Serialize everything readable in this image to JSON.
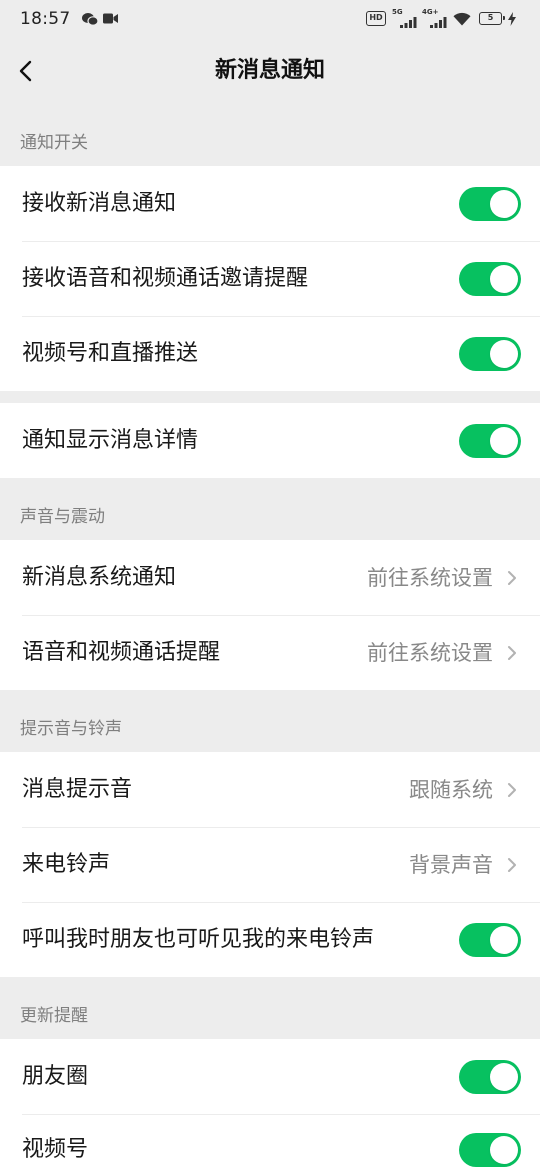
{
  "status_bar": {
    "time": "18:57",
    "hd_label": "HD",
    "sim1_label": "5G",
    "sim2_label": "4G+",
    "battery_level": "5",
    "left_icons": [
      "wechat-icon",
      "video-icon"
    ],
    "right_icons": [
      "hd-icon",
      "signal-icon",
      "signal-icon",
      "wifi-icon",
      "battery-icon",
      "charging-icon"
    ]
  },
  "nav": {
    "title": "新消息通知",
    "back_icon": "chevron-left-icon"
  },
  "colors": {
    "background": "#ededed",
    "card": "#ffffff",
    "accent": "#07c160",
    "secondary_text": "#888888"
  },
  "groups": [
    {
      "header": "通知开关",
      "rows": [
        {
          "label": "接收新消息通知",
          "toggle": true
        },
        {
          "label": "接收语音和视频通话邀请提醒",
          "toggle": true
        },
        {
          "label": "视频号和直播推送",
          "toggle": true
        }
      ]
    },
    {
      "rows": [
        {
          "label": "通知显示消息详情",
          "toggle": true
        }
      ]
    },
    {
      "header": "声音与震动",
      "rows": [
        {
          "label": "新消息系统通知",
          "value": "前往系统设置",
          "icon": "chevron-right-icon"
        },
        {
          "label": "语音和视频通话提醒",
          "value": "前往系统设置",
          "icon": "chevron-right-icon"
        }
      ]
    },
    {
      "header": "提示音与铃声",
      "rows": [
        {
          "label": "消息提示音",
          "value": "跟随系统",
          "icon": "chevron-right-icon"
        },
        {
          "label": "来电铃声",
          "value": "背景声音",
          "icon": "chevron-right-icon"
        },
        {
          "label": "呼叫我时朋友也可听见我的来电铃声",
          "toggle": true
        }
      ]
    },
    {
      "header": "更新提醒",
      "rows": [
        {
          "label": "朋友圈",
          "toggle": true
        },
        {
          "label": "视频号",
          "toggle": true
        }
      ]
    }
  ]
}
